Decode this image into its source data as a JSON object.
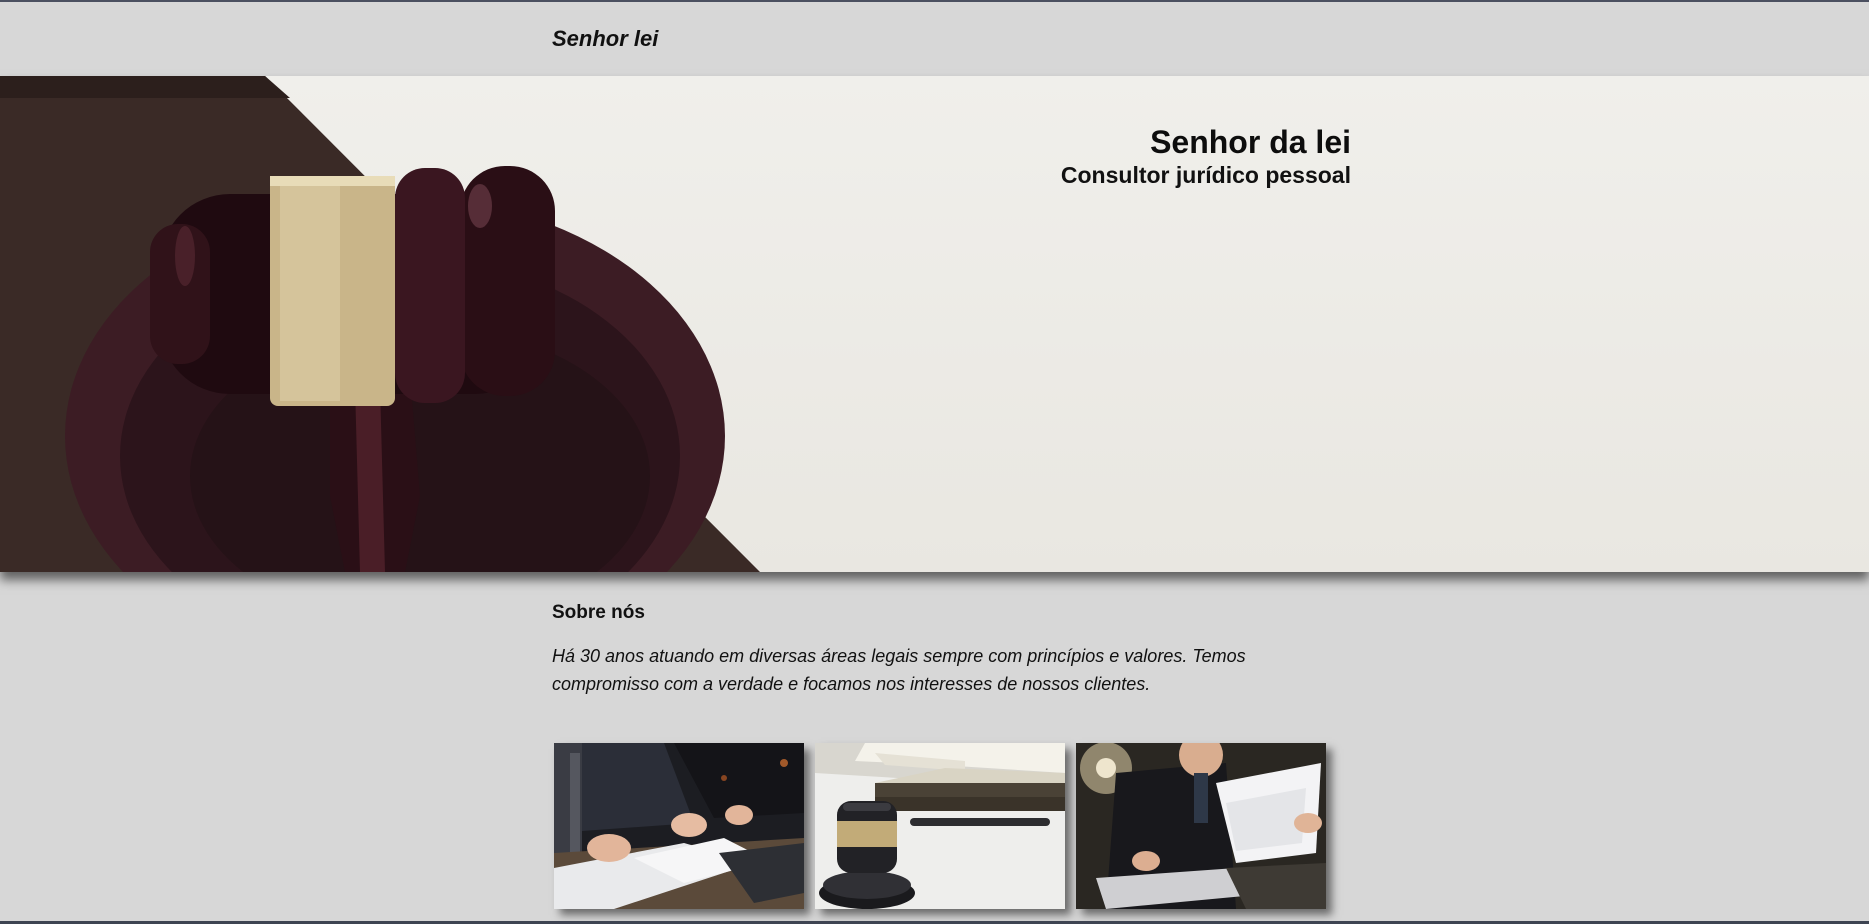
{
  "header": {
    "brand": "Senhor lei"
  },
  "hero": {
    "title": "Senhor da lei",
    "subtitle": "Consultor jurídico pessoal",
    "image": "gavel-on-sound-block"
  },
  "about": {
    "title": "Sobre nós",
    "text": "Há 30 anos atuando em diversas áreas legais sempre com princípios e valores. Temos compromisso com a verdade e focamos nos interesses de nossos clientes."
  },
  "gallery": {
    "images": [
      {
        "name": "businessmen-signing-documents"
      },
      {
        "name": "gavel-and-open-book"
      },
      {
        "name": "lawyer-reading-document"
      }
    ]
  },
  "colors": {
    "page_background": "#d7d7d7",
    "hero_background": "#ece9e3",
    "wood_dark": "#2a141a",
    "brass": "#c9b589",
    "bottom_border": "#3e4452"
  }
}
